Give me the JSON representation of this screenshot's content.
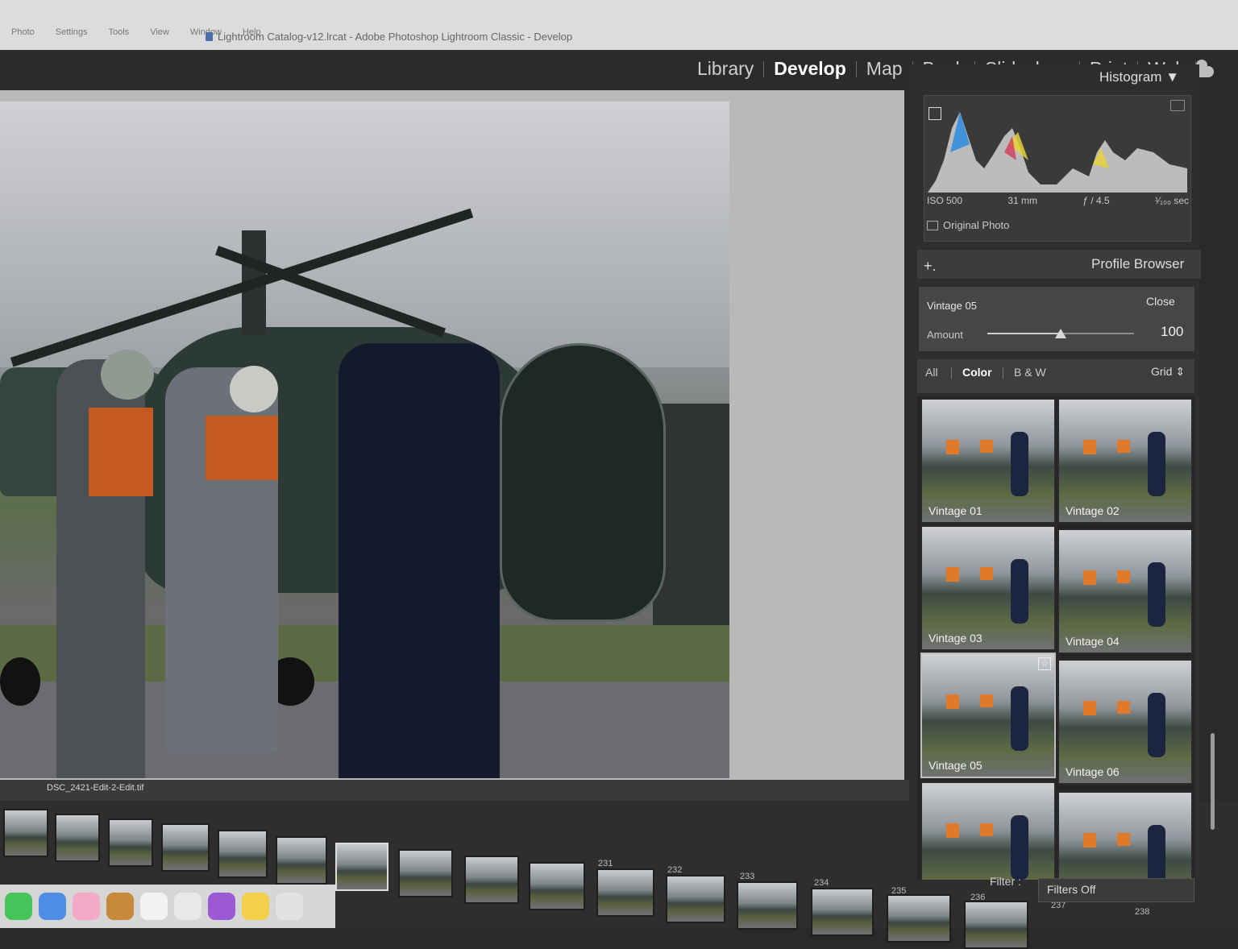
{
  "menubar": {
    "items": [
      "Photo",
      "Settings",
      "Tools",
      "View",
      "Window",
      "Help"
    ],
    "window_title": "Lightroom Catalog-v12.lrcat - Adobe Photoshop Lightroom Classic - Develop"
  },
  "modules": {
    "items": [
      "Library",
      "Develop",
      "Map",
      "Book",
      "Slideshow",
      "Print",
      "Web"
    ],
    "active": "Develop"
  },
  "histogram": {
    "title": "Histogram",
    "iso": "ISO 500",
    "focal": "31 mm",
    "aperture": "ƒ / 4.5",
    "shutter": "¹⁄₁₀₀ sec",
    "original_photo": "Original Photo"
  },
  "profile_browser": {
    "title": "Profile Browser",
    "selected_profile": "Vintage 05",
    "close_label": "Close",
    "amount_label": "Amount",
    "amount_value": "100",
    "amount_fraction": 0.5,
    "filters": [
      "All",
      "Color",
      "B & W"
    ],
    "active_filter": "Color",
    "view_mode": "Grid",
    "profiles": [
      {
        "name": "Vintage 01"
      },
      {
        "name": "Vintage 02"
      },
      {
        "name": "Vintage 03"
      },
      {
        "name": "Vintage 04"
      },
      {
        "name": "Vintage 05",
        "selected": true
      },
      {
        "name": "Vintage 06"
      },
      {
        "name": ""
      },
      {
        "name": ""
      }
    ]
  },
  "filmstrip": {
    "filename": "DSC_2421-Edit-2-Edit.tif",
    "filter_label": "Filter :",
    "filter_value": "Filters Off",
    "thumb_numbers": [
      "231",
      "232",
      "233",
      "234",
      "235",
      "236",
      "237",
      "238"
    ]
  },
  "colors": {
    "accent": "#ffffff",
    "panel_bg": "#2e2e2e",
    "vest_orange": "#c45a22"
  }
}
